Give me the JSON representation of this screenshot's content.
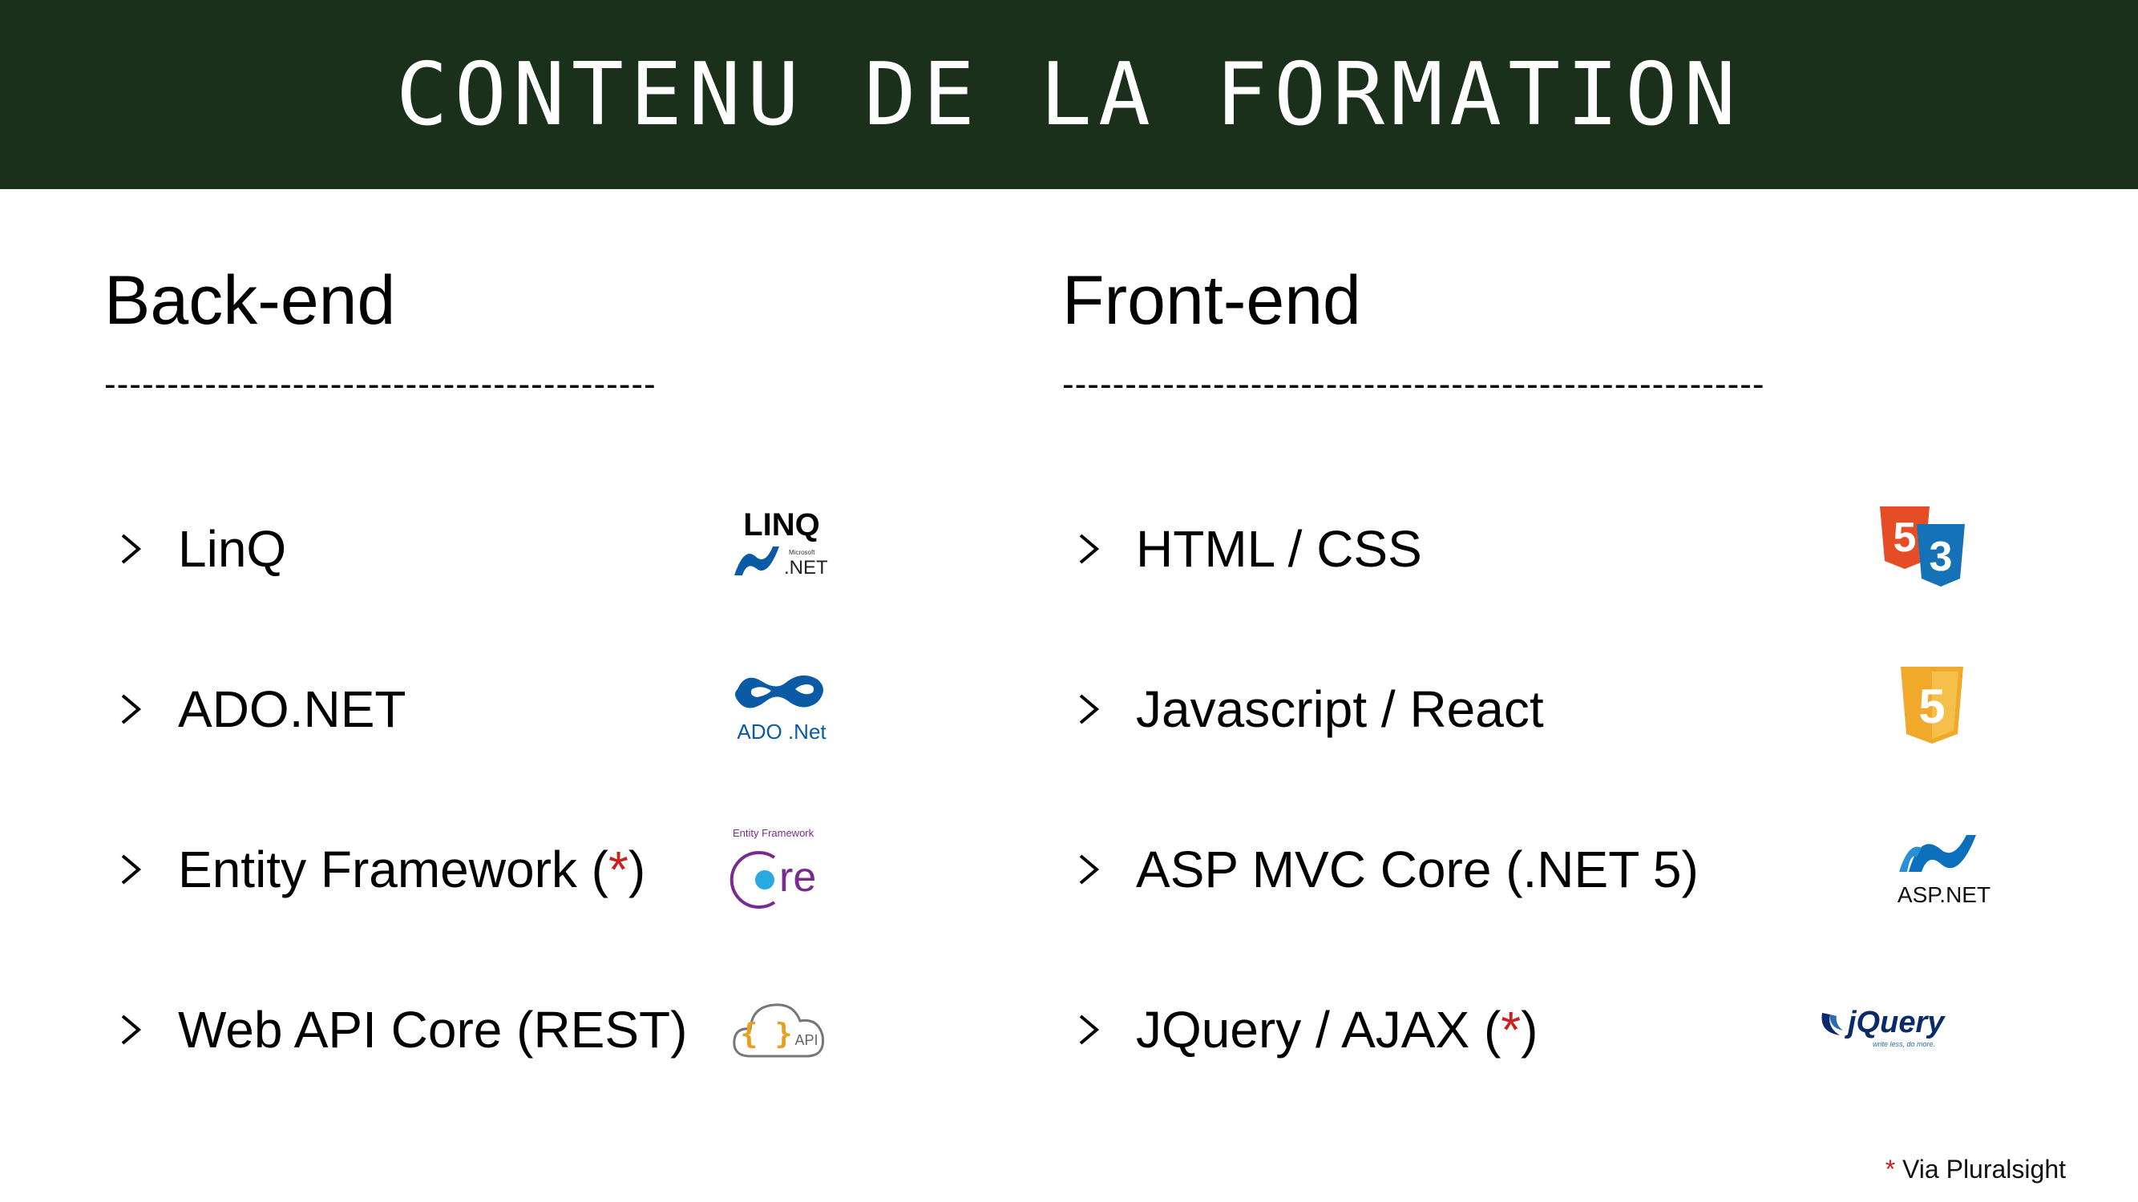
{
  "header": {
    "title": "CONTENU DE LA FORMATION"
  },
  "backend": {
    "heading": "Back-end",
    "divider": "--------------------------------------------",
    "items": [
      {
        "label": "LinQ",
        "icon": "linq-net-logo",
        "star": false
      },
      {
        "label": "ADO.NET",
        "icon": "ado-net-logo",
        "star": false
      },
      {
        "label": "Entity Framework (",
        "star_mark": "*",
        "label_end": ")",
        "icon": "entity-framework-core-logo",
        "star": true
      },
      {
        "label": "Web API Core (REST)",
        "icon": "cloud-api-icon",
        "star": false
      }
    ]
  },
  "frontend": {
    "heading": "Front-end",
    "divider": "--------------------------------------------------------",
    "items": [
      {
        "label": "HTML / CSS",
        "icon": "html5-css3-logo",
        "star": false
      },
      {
        "label": "Javascript / React",
        "icon": "javascript-logo",
        "star": false
      },
      {
        "label": "ASP MVC Core (.NET 5)",
        "icon": "asp-net-logo",
        "star": false
      },
      {
        "label": "JQuery / AJAX (",
        "star_mark": "*",
        "label_end": ")",
        "icon": "jquery-logo",
        "star": true
      }
    ]
  },
  "logos": {
    "linq_title": "LINQ",
    "linq_small": "Microsoft",
    "linq_net": ".NET",
    "ado_text": "ADO .Net",
    "ef_small": "Entity Framework",
    "ef_core": "re",
    "api_braces": "{ }",
    "api_text": "API",
    "html5_digit": "5",
    "css3_digit": "3",
    "js_digit": "5",
    "asp_text": "ASP.NET",
    "jquery_text": "jQuery",
    "jquery_tag": "write less, do more."
  },
  "footnote": {
    "star": "*",
    "text": " Via Pluralsight"
  },
  "colors": {
    "header_bg": "#1b301b",
    "star_red": "#cc1f1f",
    "ado_blue": "#0a5aa5",
    "ef_purple": "#7b2b8f",
    "ef_cyan": "#2aa8e0",
    "html_orange": "#e44d26",
    "css_blue": "#1572b6",
    "js_yellow": "#f0a92b",
    "asp_blue": "#0b6fbb",
    "jquery_navy": "#0a2a6a"
  }
}
